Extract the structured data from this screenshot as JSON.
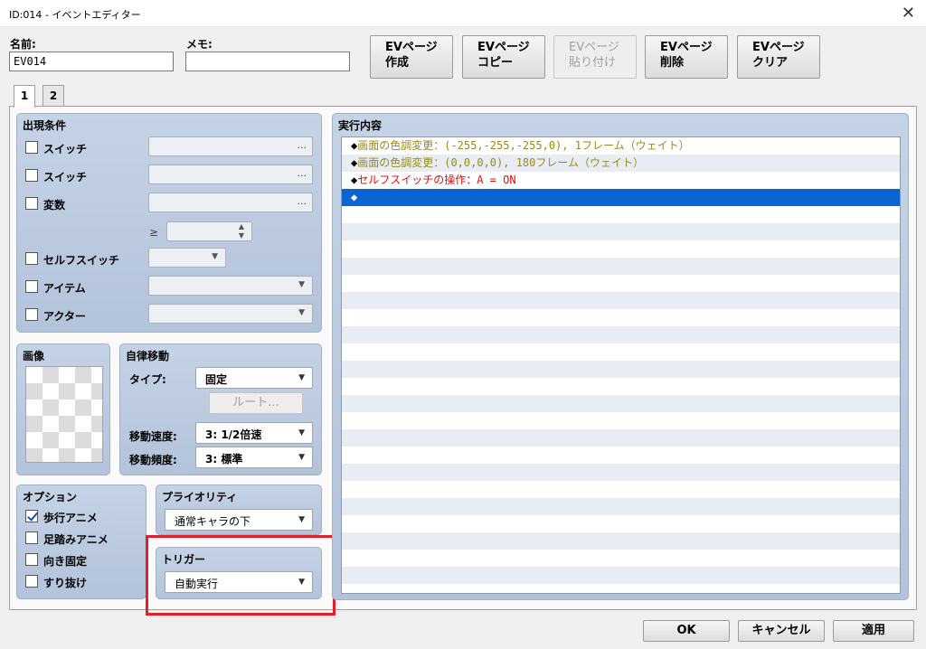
{
  "window": {
    "title": "ID:014 - イベントエディター",
    "close_glyph": "✕"
  },
  "name_field": {
    "label": "名前:",
    "value": "EV014"
  },
  "memo_field": {
    "label": "メモ:",
    "value": ""
  },
  "page_buttons": [
    {
      "line1": "EVページ",
      "line2": "作成",
      "enabled": true
    },
    {
      "line1": "EVページ",
      "line2": "コピー",
      "enabled": true
    },
    {
      "line1": "EVページ",
      "line2": "貼り付け",
      "enabled": false
    },
    {
      "line1": "EVページ",
      "line2": "削除",
      "enabled": true
    },
    {
      "line1": "EVページ",
      "line2": "クリア",
      "enabled": true
    }
  ],
  "tabs": [
    {
      "label": "1",
      "active": true
    },
    {
      "label": "2",
      "active": false
    }
  ],
  "conditions": {
    "title": "出現条件",
    "switch1": "スイッチ",
    "switch2": "スイッチ",
    "variable": "変数",
    "ge_symbol": "≥",
    "self_switch": "セルフスイッチ",
    "item": "アイテム",
    "actor": "アクター",
    "ellipsis": "..."
  },
  "image": {
    "title": "画像"
  },
  "autonomous": {
    "title": "自律移動",
    "type_label": "タイプ:",
    "type_value": "固定",
    "route_button": "ルート...",
    "speed_label": "移動速度:",
    "speed_value": "3: 1/2倍速",
    "freq_label": "移動頻度:",
    "freq_value": "3: 標準"
  },
  "options": {
    "title": "オプション",
    "items": [
      {
        "label": "歩行アニメ",
        "checked": true
      },
      {
        "label": "足踏みアニメ",
        "checked": false
      },
      {
        "label": "向き固定",
        "checked": false
      },
      {
        "label": "すり抜け",
        "checked": false
      }
    ]
  },
  "priority": {
    "title": "プライオリティ",
    "value": "通常キャラの下"
  },
  "trigger": {
    "title": "トリガー",
    "value": "自動実行"
  },
  "contents": {
    "title": "実行内容",
    "rows": [
      {
        "marker": "◆",
        "text": "画面の色調変更：(-255,-255,-255,0), 1フレーム（ウェイト）",
        "kind": "tint"
      },
      {
        "marker": "◆",
        "text": "画面の色調変更：(0,0,0,0), 180フレーム（ウェイト）",
        "kind": "tint"
      },
      {
        "marker": "◆",
        "text": "セルフスイッチの操作：A = ON",
        "kind": "self"
      },
      {
        "marker": "◆",
        "text": "",
        "kind": "sel"
      }
    ]
  },
  "footer": {
    "ok": "OK",
    "cancel": "キャンセル",
    "apply": "適用"
  },
  "colors": {
    "selection": "#0a64d2",
    "tint_text": "#9a8a1a",
    "self_text": "#e01010",
    "highlight_box": "#e0202a"
  }
}
